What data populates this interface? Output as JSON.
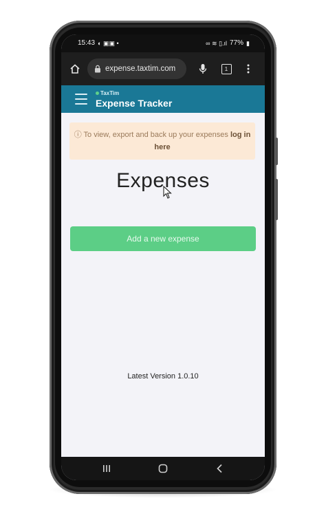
{
  "status_bar": {
    "time": "15:43",
    "battery": "77%"
  },
  "browser": {
    "url": "expense.taxtim.com",
    "tab_count": "1"
  },
  "header": {
    "brand": "TaxTim",
    "title": "Expense Tracker",
    "brand_color": "#1a7896"
  },
  "notice": {
    "text": "To view, export and back up your expenses",
    "link": "log in here",
    "bg_color": "#fce9d6"
  },
  "main": {
    "title": "Expenses",
    "add_button": "Add a new expense",
    "button_color": "#5cce86",
    "version": "Latest  Version 1.0.10"
  }
}
